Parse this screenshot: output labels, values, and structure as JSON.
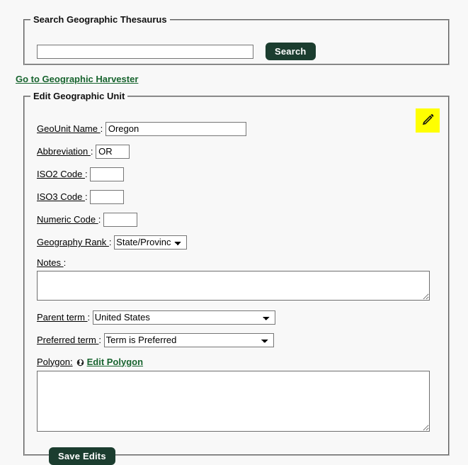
{
  "search_panel": {
    "legend": "Search Geographic Thesaurus",
    "input_value": "",
    "input_placeholder": "",
    "search_button": "Search"
  },
  "harvester_link": "Go to Geographic Harvester",
  "edit_panel": {
    "legend": "Edit Geographic Unit",
    "fields": {
      "geounit_name_label": "GeoUnit Name ",
      "geounit_name_value": "Oregon",
      "abbreviation_label": "Abbreviation ",
      "abbreviation_value": "OR",
      "iso2_label": "ISO2 Code ",
      "iso2_value": "",
      "iso3_label": "ISO3 Code ",
      "iso3_value": "",
      "numeric_label": "Numeric Code ",
      "numeric_value": "",
      "geography_rank_label": "Geography Rank ",
      "geography_rank_value": "State/Province",
      "notes_label": "Notes ",
      "notes_value": "",
      "parent_term_label": "Parent term ",
      "parent_term_value": "United States",
      "preferred_term_label": "Preferred term ",
      "preferred_term_value": "Term is Preferred",
      "polygon_label": "Polygon:",
      "edit_polygon_link": "Edit Polygon",
      "polygon_value": "",
      "colon": ":"
    },
    "save_button": "Save Edits"
  },
  "icons": {
    "pencil": "pencil-icon",
    "globe": "globe-icon"
  },
  "colors": {
    "accent_green": "#1b3d2f",
    "link_green": "#17642e",
    "highlight_yellow": "#ffff00",
    "page_background": "#f8f8f8"
  }
}
